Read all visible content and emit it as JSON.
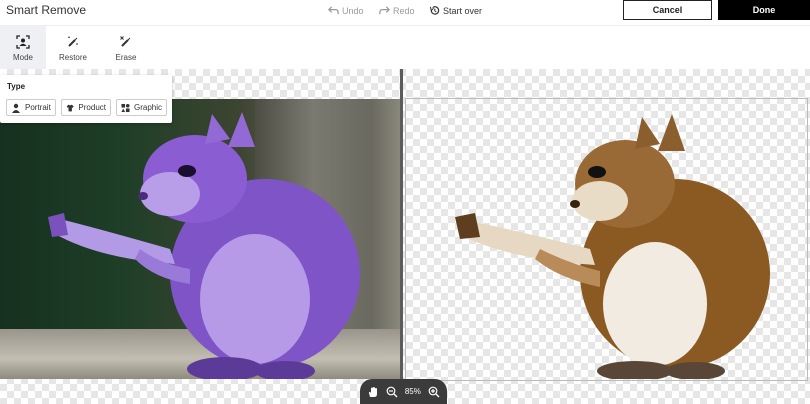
{
  "app": {
    "title": "Smart Remove"
  },
  "history": {
    "undo": "Undo",
    "redo": "Redo",
    "start_over": "Start over"
  },
  "actions": {
    "cancel": "Cancel",
    "done": "Done"
  },
  "toolbar": {
    "mode": "Mode",
    "restore": "Restore",
    "erase": "Erase"
  },
  "type_popup": {
    "title": "Type",
    "portrait": "Portrait",
    "product": "Product",
    "graphic": "Graphic"
  },
  "zoom": {
    "level": "85%"
  },
  "colors": {
    "done_bg": "#000000",
    "selection_overlay": "#8a5bd8",
    "divider": "#5c5c5c"
  }
}
